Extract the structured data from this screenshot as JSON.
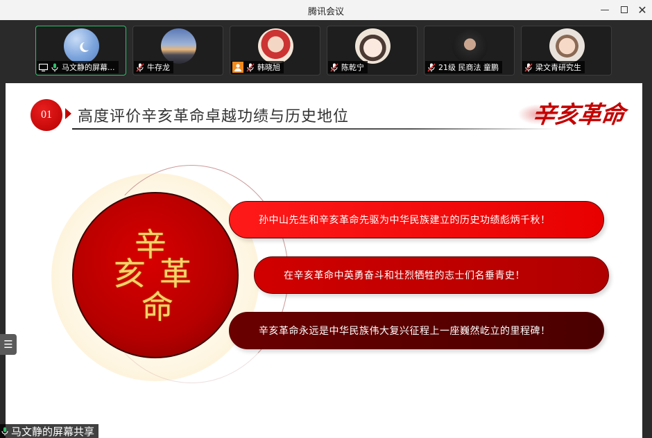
{
  "window": {
    "title": "腾讯会议"
  },
  "participants": [
    {
      "name": "马文静的屏幕...",
      "mic": "on",
      "sharing": true,
      "active": true
    },
    {
      "name": "牛存龙",
      "mic": "muted"
    },
    {
      "name": "韩晓旭",
      "mic": "muted",
      "host_badge": true
    },
    {
      "name": "陈乾宁",
      "mic": "muted"
    },
    {
      "name": "21级 民商法 童鹏",
      "mic": "muted"
    },
    {
      "name": "梁文青研究生",
      "mic": "muted"
    }
  ],
  "slide": {
    "section_number": "01",
    "section_title": "高度评价辛亥革命卓越功绩与历史地位",
    "brand_text": "辛亥革命",
    "circle_chars": [
      "辛",
      "亥",
      "革",
      "命"
    ],
    "points": [
      "孙中山先生和辛亥革命先驱为中华民族建立的历史功绩彪炳千秋！",
      "在辛亥革命中英勇奋斗和壮烈牺牲的志士们名垂青史！",
      "辛亥革命永远是中华民族伟大复兴征程上一座巍然屹立的里程碑！"
    ]
  },
  "share_label": "马文静的屏幕共享",
  "colors": {
    "accent_green": "#2fbf6a",
    "brand_red": "#c40000",
    "dark_red": "#4a0000"
  }
}
